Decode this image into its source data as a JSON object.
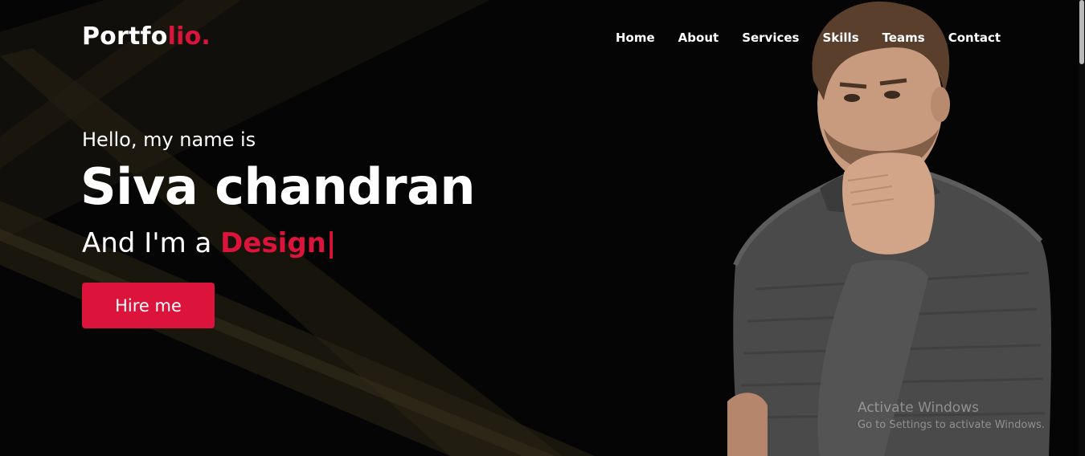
{
  "logo": {
    "text": "Portfo",
    "accent": "lio."
  },
  "nav": {
    "items": [
      {
        "label": "Home"
      },
      {
        "label": "About"
      },
      {
        "label": "Services"
      },
      {
        "label": "Skills"
      },
      {
        "label": "Teams"
      },
      {
        "label": "Contact"
      }
    ]
  },
  "hero": {
    "greeting": "Hello, my name is",
    "name": "Siva chandran",
    "role_prefix": "And I'm a ",
    "role_typed": "Design",
    "role_cursor": "|",
    "button_label": "Hire me"
  },
  "watermark": {
    "title": "Activate Windows",
    "subtitle": "Go to Settings to activate Windows."
  },
  "colors": {
    "accent": "#dc143c",
    "background": "#050505",
    "text": "#ffffff"
  },
  "icons": {
    "portrait": "person-portrait-image"
  }
}
